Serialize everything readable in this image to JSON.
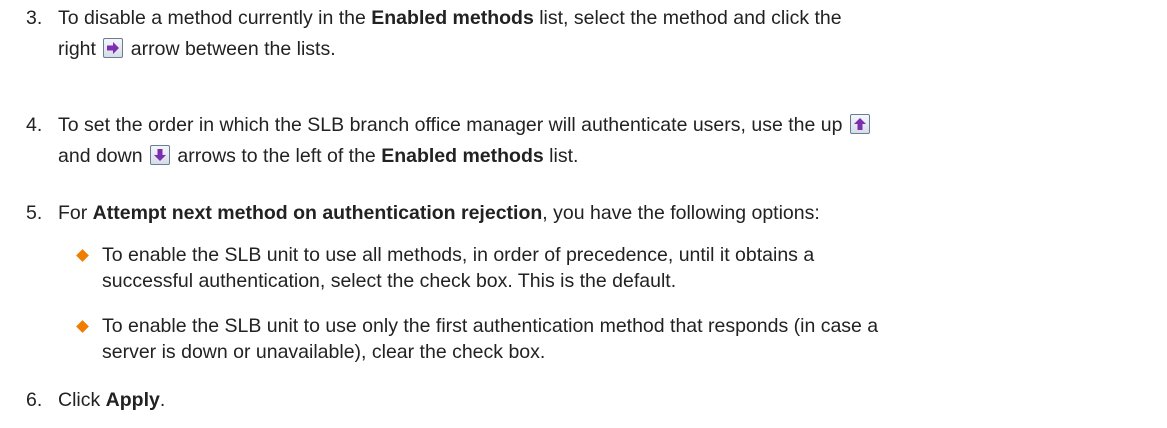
{
  "steps": [
    {
      "number": "3.",
      "text1": "To disable a method currently in the ",
      "bold1": "Enabled methods",
      "text2": " list, select the method and click the",
      "text3": "right",
      "text4": "arrow between the lists.",
      "icon": "right-arrow-icon"
    },
    {
      "number": "4.",
      "text1": "To set the order in which the SLB branch office manager will authenticate users, use the up",
      "text2": "and down",
      "text3": "arrows to the left of the ",
      "bold1": "Enabled methods",
      "text4": " list.",
      "icons": [
        "up-arrow-icon",
        "down-arrow-icon"
      ]
    },
    {
      "number": "5.",
      "text1": "For ",
      "bold1": "Attempt next method on authentication rejection",
      "text2": ", you have the following options:",
      "bullets": [
        {
          "line1": "To enable the SLB unit to use all methods, in order of precedence, until it obtains a",
          "line2": "successful authentication, select the check box. This is the default."
        },
        {
          "line1": "To enable the SLB unit to use only the first authentication method that responds (in case a",
          "line2": "server is down or unavailable), clear the check box."
        }
      ]
    },
    {
      "number": "6.",
      "text1": "Click ",
      "bold1": "Apply",
      "text2": "."
    }
  ],
  "colors": {
    "text": "#222222",
    "bullet": "#f07c00",
    "arrow": "#7b2fb0"
  }
}
